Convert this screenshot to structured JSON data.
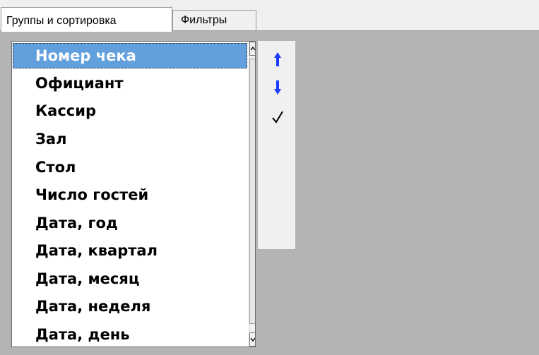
{
  "tabs": [
    {
      "label": "Группы и сортировка",
      "active": true
    },
    {
      "label": "Фильтры",
      "active": false
    }
  ],
  "fields_list": {
    "items": [
      {
        "label": "Номер чека",
        "selected": true
      },
      {
        "label": "Официант",
        "selected": false
      },
      {
        "label": "Кассир",
        "selected": false
      },
      {
        "label": "Зал",
        "selected": false
      },
      {
        "label": "Стол",
        "selected": false
      },
      {
        "label": "Число гостей",
        "selected": false
      },
      {
        "label": "Дата, год",
        "selected": false
      },
      {
        "label": "Дата, квартал",
        "selected": false
      },
      {
        "label": "Дата, месяц",
        "selected": false
      },
      {
        "label": "Дата, неделя",
        "selected": false
      },
      {
        "label": "Дата, день",
        "selected": false
      }
    ]
  },
  "tool_buttons": [
    {
      "icon": "arrow-up-icon"
    },
    {
      "icon": "arrow-down-icon"
    },
    {
      "icon": "checkmark-icon"
    }
  ],
  "colors": {
    "selection": "#62a0dd",
    "arrow": "#1a3cff",
    "panel_bg": "#b4b4b4"
  }
}
